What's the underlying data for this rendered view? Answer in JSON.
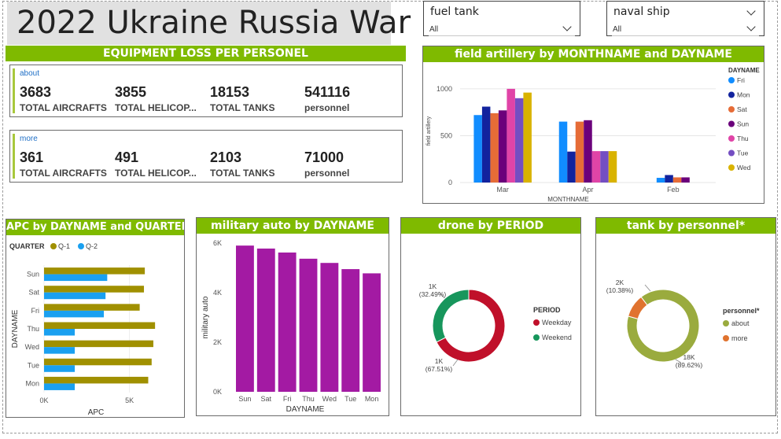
{
  "title": "2022 Ukraine Russia War",
  "slicers": [
    {
      "label": "fuel tank",
      "value": "All"
    },
    {
      "label": "naval ship",
      "value": "All"
    }
  ],
  "equipment_header": "EQUIPMENT LOSS PER PERSONEL",
  "cards": [
    {
      "section": "about",
      "kpis": [
        {
          "value": "3683",
          "label": "TOTAL AIRCRAFTS"
        },
        {
          "value": "3855",
          "label": "TOTAL HELICOP..."
        },
        {
          "value": "18153",
          "label": "TOTAL TANKS"
        },
        {
          "value": "541116",
          "label": "personnel"
        }
      ]
    },
    {
      "section": "more",
      "kpis": [
        {
          "value": "361",
          "label": "TOTAL AIRCRAFTS"
        },
        {
          "value": "491",
          "label": "TOTAL HELICOP..."
        },
        {
          "value": "2103",
          "label": "TOTAL TANKS"
        },
        {
          "value": "71000",
          "label": "personnel"
        }
      ]
    }
  ],
  "chart_data": [
    {
      "id": "field-artillery",
      "type": "bar",
      "title": "field artillery by MONTHNAME and DAYNAME",
      "xlabel": "MONTHNAME",
      "ylabel": "field artillery",
      "categories": [
        "Mar",
        "Apr",
        "Feb"
      ],
      "yticks": [
        "0",
        "500",
        "1000"
      ],
      "ylim": [
        0,
        1100
      ],
      "legend_title": "DAYNAME",
      "legend_position": "right",
      "series": [
        {
          "name": "Fri",
          "color": "#118dff",
          "values": [
            720,
            650,
            50
          ]
        },
        {
          "name": "Mon",
          "color": "#12239e",
          "values": [
            810,
            330,
            80
          ]
        },
        {
          "name": "Sat",
          "color": "#e66c37",
          "values": [
            740,
            650,
            55
          ]
        },
        {
          "name": "Sun",
          "color": "#6b007b",
          "values": [
            770,
            665,
            55
          ]
        },
        {
          "name": "Thu",
          "color": "#e044a7",
          "values": [
            1000,
            335,
            null
          ]
        },
        {
          "name": "Tue",
          "color": "#744ec2",
          "values": [
            900,
            335,
            null
          ]
        },
        {
          "name": "Wed",
          "color": "#d9b300",
          "values": [
            960,
            335,
            null
          ]
        }
      ]
    },
    {
      "id": "apc",
      "type": "bar",
      "orientation": "horizontal",
      "title": "APC by DAYNAME and QUARTER",
      "xlabel": "APC",
      "ylabel": "DAYNAME",
      "categories": [
        "Sun",
        "Sat",
        "Fri",
        "Thu",
        "Wed",
        "Tue",
        "Mon"
      ],
      "xticks": [
        "0K",
        "5K"
      ],
      "xlim": [
        0,
        7000
      ],
      "legend_title": "QUARTER",
      "legend_position": "top-left",
      "series": [
        {
          "name": "Q-1",
          "color": "#a09000",
          "values": [
            5900,
            5850,
            5600,
            6500,
            6400,
            6300,
            6100
          ]
        },
        {
          "name": "Q-2",
          "color": "#1aa0f0",
          "values": [
            3700,
            3600,
            3500,
            1800,
            1800,
            1800,
            1800
          ]
        }
      ]
    },
    {
      "id": "military-auto",
      "type": "bar",
      "title": "military auto by DAYNAME",
      "xlabel": "DAYNAME",
      "ylabel": "military auto",
      "categories": [
        "Sun",
        "Sat",
        "Fri",
        "Thu",
        "Wed",
        "Tue",
        "Mon"
      ],
      "yticks": [
        "0K",
        "2K",
        "4K",
        "6K"
      ],
      "ylim": [
        0,
        6000
      ],
      "series": [
        {
          "name": "",
          "color": "#a31aa3",
          "values": [
            5900,
            5780,
            5620,
            5370,
            5200,
            4950,
            4780
          ]
        }
      ]
    },
    {
      "id": "drone",
      "type": "pie",
      "donut": true,
      "title": "drone by PERIOD",
      "legend_title": "PERIOD",
      "legend_position": "right",
      "slices": [
        {
          "name": "Weekday",
          "color": "#c0102a",
          "value": 67.51,
          "label_value": "1K",
          "label_pct": "(67.51%)"
        },
        {
          "name": "Weekend",
          "color": "#17965c",
          "value": 32.49,
          "label_value": "1K",
          "label_pct": "(32.49%)"
        }
      ]
    },
    {
      "id": "tank",
      "type": "pie",
      "donut": true,
      "title": "tank by personnel*",
      "legend_title": "personnel*",
      "legend_position": "right",
      "slices": [
        {
          "name": "about",
          "color": "#9aab3e",
          "value": 89.62,
          "label_value": "18K",
          "label_pct": "(89.62%)"
        },
        {
          "name": "more",
          "color": "#e0732f",
          "value": 10.38,
          "label_value": "2K",
          "label_pct": "(10.38%)"
        }
      ]
    }
  ]
}
